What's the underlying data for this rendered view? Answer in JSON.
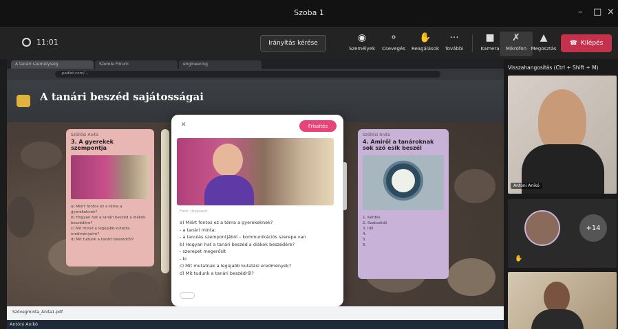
{
  "window": {
    "title": "Szoba 1",
    "controls": [
      "–",
      "□",
      "×"
    ]
  },
  "meeting": {
    "timer": "11:01",
    "record_label": "Irányítás kérése",
    "tools": [
      {
        "icon": "people-icon",
        "label": "Személyek"
      },
      {
        "icon": "chat-icon",
        "label": "Csevegés"
      },
      {
        "icon": "reactions-icon",
        "label": "Reagálások"
      },
      {
        "icon": "more-icon",
        "label": "További"
      }
    ],
    "media": [
      {
        "icon": "camera-icon",
        "label": "Kamera"
      },
      {
        "icon": "mic-off-icon",
        "label": "Mikrofon"
      },
      {
        "icon": "share-icon",
        "label": "Megosztás"
      }
    ],
    "leave_label": "Kilépés"
  },
  "browser": {
    "tabs": [
      "A tanári személyiség",
      "Szemle Fórum",
      "engineering"
    ],
    "url": "padlet.com/..."
  },
  "padlet": {
    "title": "A tanári beszéd sajátosságai",
    "columns": [
      {
        "header": "Szöllősi Anita",
        "title": "3. A gyerekek szempontja",
        "lines": [
          "a) Miért fontos ez a téma a gyerekeknek?",
          "b) Hogyan hat a tanári beszéd a diákok",
          "beszédére?",
          "c) Mit mond a legújabb kutatás",
          "eredményeire?",
          "d) Mit tudunk a tanári beszédről?"
        ],
        "bg": "#e8b7b3"
      },
      {
        "header": "Szöllősi Anita",
        "title": "4. Amiről a tanároknak sok szó esik beszél",
        "lines": [
          "1. Kérdés",
          "2. Szabadidő",
          "3. Idő",
          "4.",
          "5.",
          "6."
        ],
        "bg": "#c9b2d8"
      }
    ]
  },
  "modal": {
    "action_label": "Frissítés",
    "caption": "Fotó: Unsplash",
    "lines": [
      "a) Miért fontos ez a téma a gyerekeknek?",
      "- a tanári minta;",
      "- a tanulás szempontjából – kommunikációs szerepe van",
      "b) Hogyan hat a tanári beszéd a diákok beszédére?",
      "- szerepet megerősít",
      "- ki",
      "c) Mit mutatnak a legújabb kutatási eredmények?",
      "d) Mit tudunk a tanári beszédről?"
    ]
  },
  "download": {
    "file": "Szövegminta_Anita1.pdf"
  },
  "side": {
    "header": "Visszahangosítás (Ctrl + Shift + M)",
    "participant1": "Antóni Anikó",
    "overflow_count": "+14"
  },
  "taskbar_label": "Antóni Anikó",
  "colors": {
    "accent": "#e7457a",
    "leave": "#c4314b"
  }
}
